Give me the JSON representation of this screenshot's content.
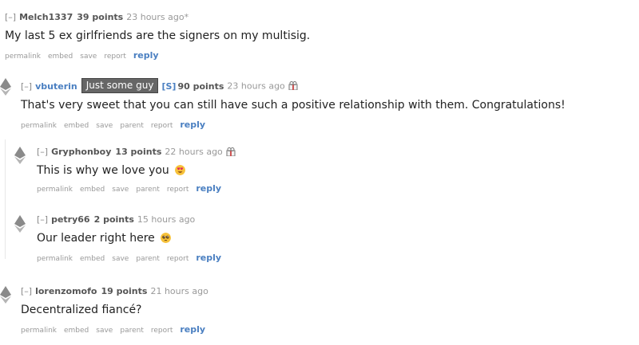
{
  "comments": [
    {
      "toggle": "[–]",
      "author": "Melch1337",
      "points": "39 points",
      "time": "23 hours ago*",
      "body": "My last 5 ex girlfriends are the signers on my multisig.",
      "buttons": [
        "permalink",
        "embed",
        "save",
        "report"
      ],
      "reply": "reply"
    },
    {
      "toggle": "[–]",
      "author": "vbuterin",
      "flair": "Just some guy",
      "mod_badge": "[S]",
      "points": "90 points",
      "time": "23 hours ago",
      "body": "That's very sweet that you can still have such a positive relationship with them. Congratulations!",
      "buttons": [
        "permalink",
        "embed",
        "save",
        "parent",
        "report"
      ],
      "reply": "reply"
    },
    {
      "toggle": "[–]",
      "author": "Gryphonboy",
      "points": "13 points",
      "time": "22 hours ago",
      "body": "This is why we love you",
      "emoji": "heart-eyes-emoji",
      "buttons": [
        "permalink",
        "embed",
        "save",
        "parent",
        "report"
      ],
      "reply": "reply"
    },
    {
      "toggle": "[–]",
      "author": "petry66",
      "points": "2 points",
      "time": "15 hours ago",
      "body": "Our leader right here",
      "emoji": "pleading-face-emoji",
      "buttons": [
        "permalink",
        "embed",
        "save",
        "parent",
        "report"
      ],
      "reply": "reply"
    },
    {
      "toggle": "[–]",
      "author": "lorenzomofo",
      "points": "19 points",
      "time": "21 hours ago",
      "body": "Decentralized fiancé?",
      "buttons": [
        "permalink",
        "embed",
        "save",
        "parent",
        "report"
      ],
      "reply": "reply"
    }
  ],
  "colors": {
    "link_blue": "#4a7fc1",
    "meta_gray": "#888888",
    "flair_bg": "#666666"
  }
}
